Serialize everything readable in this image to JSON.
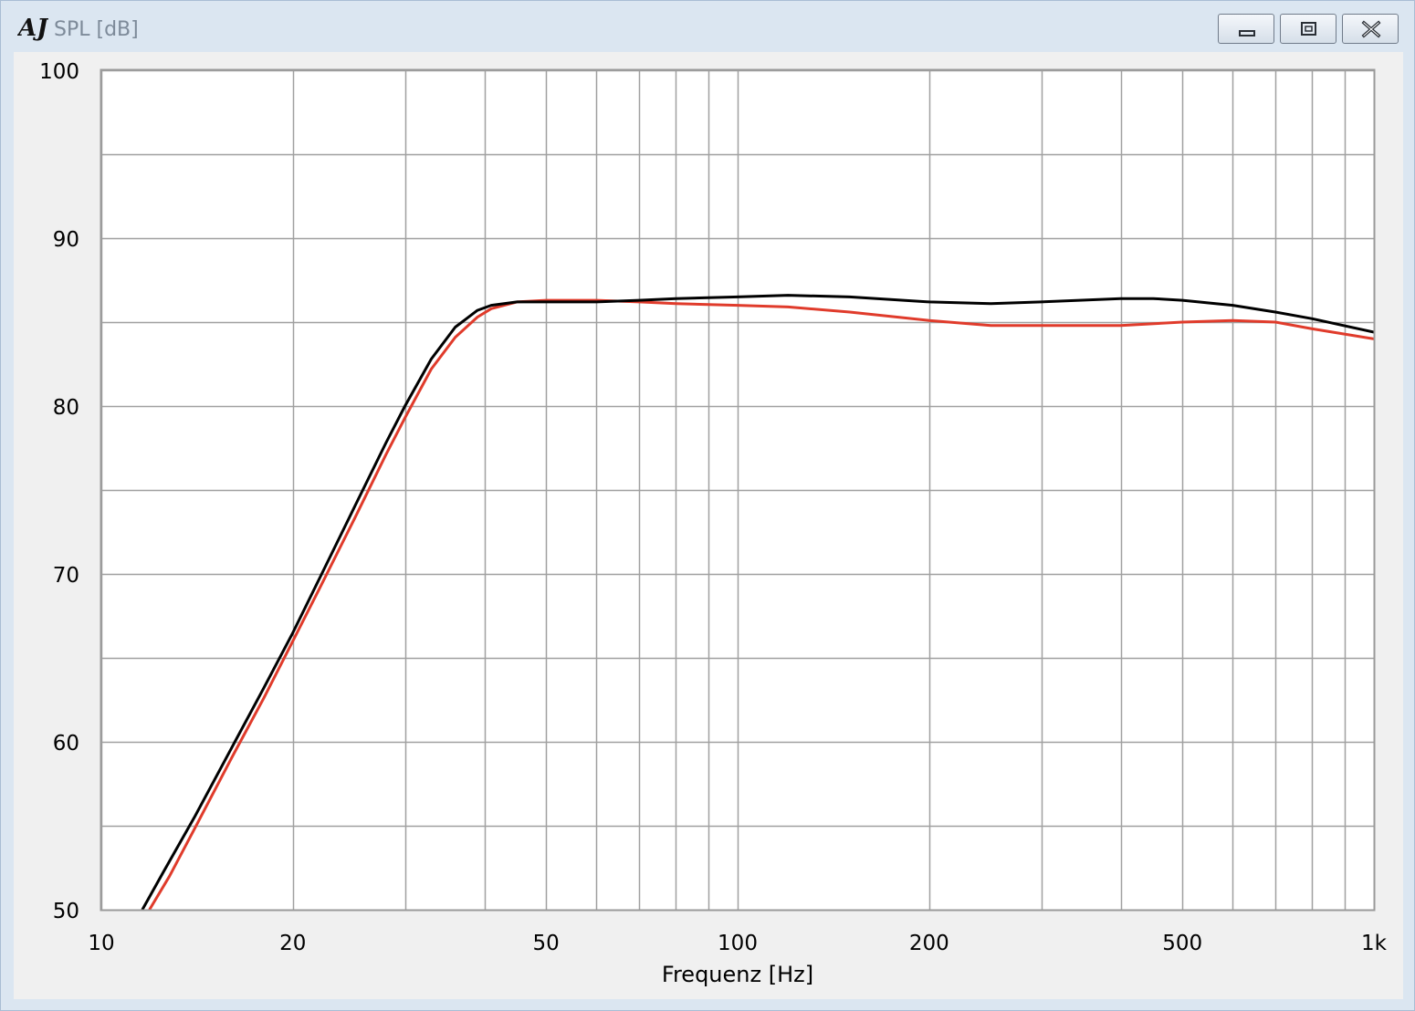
{
  "window": {
    "title": "SPL [dB]",
    "logo_text": "AJ",
    "buttons": {
      "minimize": "minimize",
      "restore": "restore",
      "close": "close"
    }
  },
  "chart_data": {
    "type": "line",
    "title": "",
    "xlabel": "Frequenz [Hz]",
    "ylabel": "SPL [dB]",
    "x_scale": "log",
    "xlim": [
      10,
      1000
    ],
    "ylim": [
      50,
      100
    ],
    "x_ticks": [
      {
        "value": 10,
        "label": "10"
      },
      {
        "value": 20,
        "label": "20"
      },
      {
        "value": 50,
        "label": "50"
      },
      {
        "value": 100,
        "label": "100"
      },
      {
        "value": 200,
        "label": "200"
      },
      {
        "value": 500,
        "label": "500"
      },
      {
        "value": 1000,
        "label": "1k"
      }
    ],
    "y_ticks": [
      {
        "value": 50,
        "label": "50"
      },
      {
        "value": 60,
        "label": "60"
      },
      {
        "value": 70,
        "label": "70"
      },
      {
        "value": 80,
        "label": "80"
      },
      {
        "value": 90,
        "label": "90"
      },
      {
        "value": 100,
        "label": "100"
      }
    ],
    "x_grid": [
      10,
      20,
      30,
      40,
      50,
      60,
      70,
      80,
      90,
      100,
      200,
      300,
      400,
      500,
      600,
      700,
      800,
      900,
      1000
    ],
    "y_grid": [
      50,
      55,
      60,
      65,
      70,
      75,
      80,
      85,
      90,
      95,
      100
    ],
    "grid": true,
    "series": [
      {
        "color": "#000000",
        "x": [
          11.6,
          12.5,
          14,
          16,
          18,
          20,
          22,
          25,
          28,
          30,
          33,
          36,
          39,
          41,
          45,
          50,
          60,
          70,
          80,
          100,
          120,
          150,
          200,
          250,
          300,
          400,
          450,
          500,
          600,
          700,
          800,
          1000
        ],
        "y": [
          50.0,
          52.2,
          55.5,
          59.6,
          63.2,
          66.5,
          69.7,
          74.0,
          77.8,
          80.0,
          82.8,
          84.7,
          85.7,
          86.0,
          86.2,
          86.2,
          86.2,
          86.3,
          86.4,
          86.5,
          86.6,
          86.5,
          86.2,
          86.1,
          86.2,
          86.4,
          86.4,
          86.3,
          86.0,
          85.6,
          85.2,
          84.4
        ]
      },
      {
        "color": "#e03b2b",
        "x": [
          11.9,
          12.8,
          14,
          16,
          18,
          20,
          22,
          25,
          28,
          30,
          33,
          36,
          39,
          41,
          45,
          50,
          60,
          70,
          80,
          100,
          120,
          150,
          200,
          250,
          300,
          400,
          500,
          600,
          700,
          800,
          1000
        ],
        "y": [
          50.0,
          52.0,
          54.8,
          59.0,
          62.6,
          66.0,
          69.1,
          73.3,
          77.1,
          79.3,
          82.2,
          84.1,
          85.3,
          85.8,
          86.2,
          86.3,
          86.3,
          86.2,
          86.1,
          86.0,
          85.9,
          85.6,
          85.1,
          84.8,
          84.8,
          84.8,
          85.0,
          85.1,
          85.0,
          84.6,
          84.0
        ]
      }
    ]
  }
}
